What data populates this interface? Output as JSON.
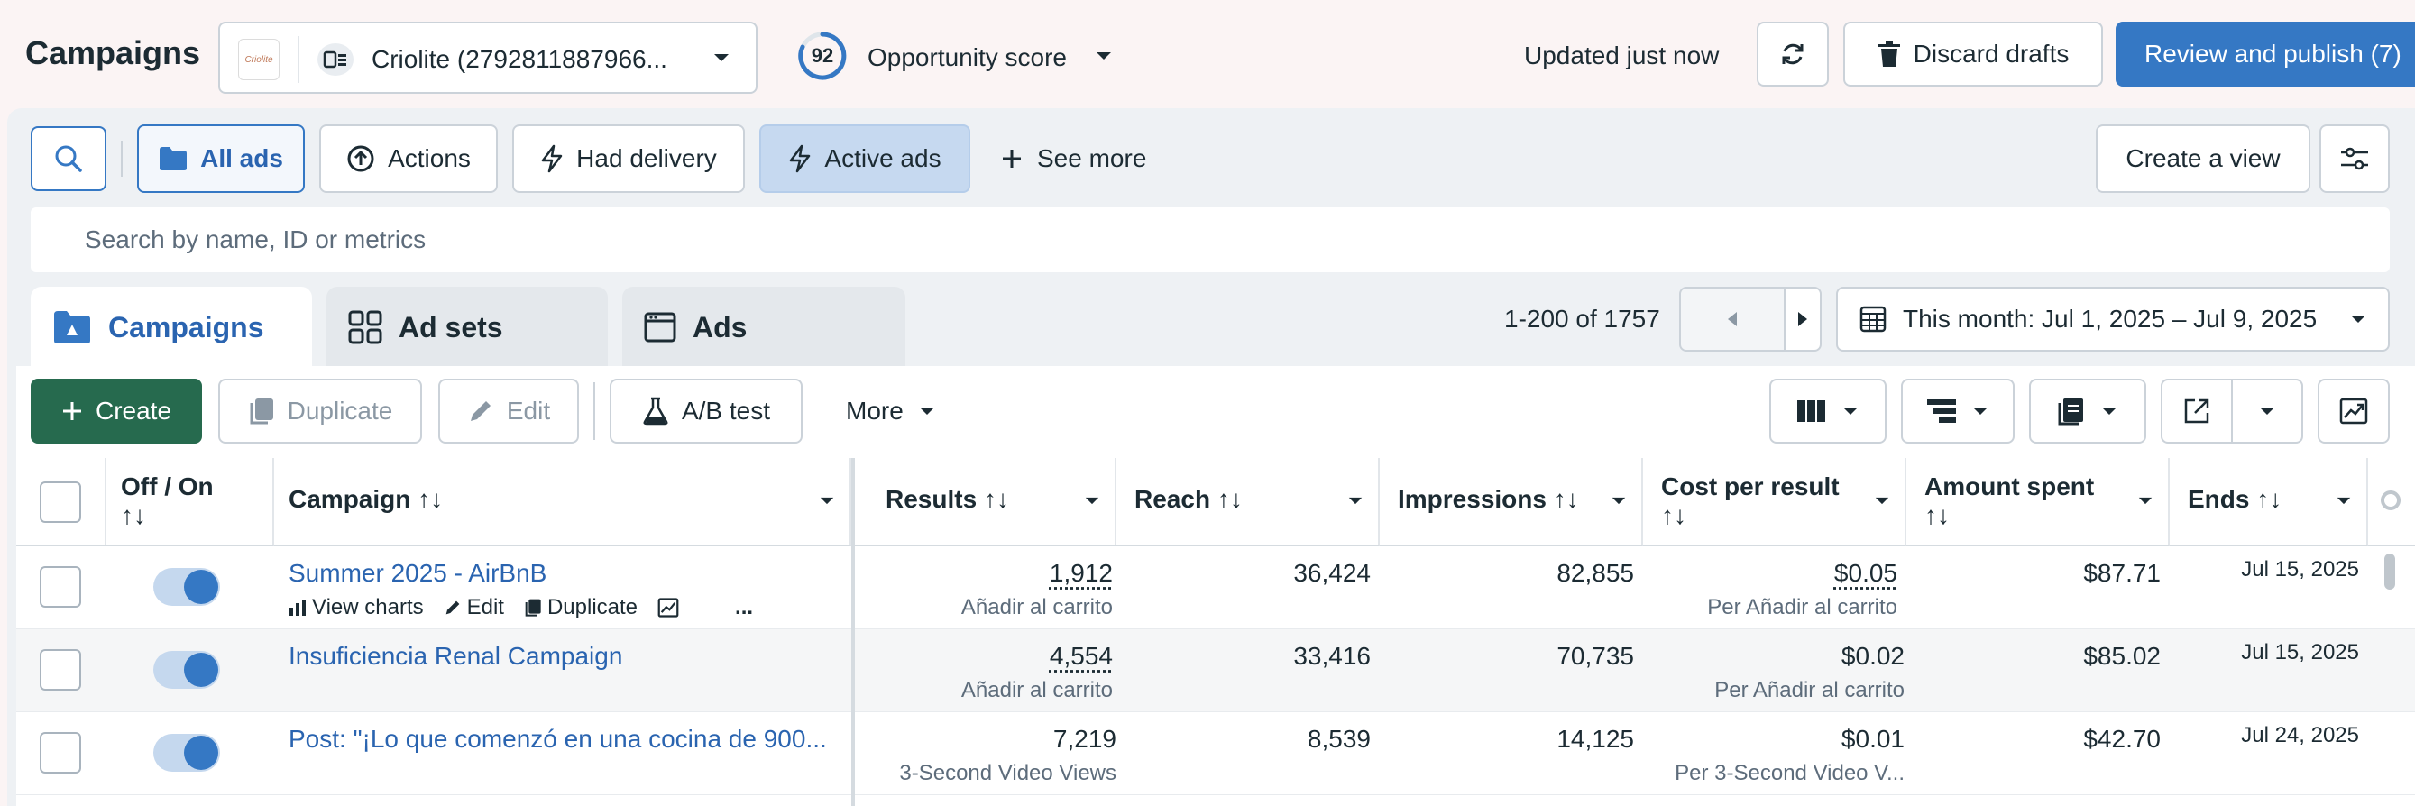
{
  "header": {
    "title": "Campaigns",
    "account_logo_text": "Criolite",
    "account_name": "Criolite (2792811887966...",
    "opportunity_score": "92",
    "opportunity_label": "Opportunity score",
    "updated": "Updated just now",
    "discard_label": "Discard drafts",
    "publish_label": "Review and publish (7)"
  },
  "filters": {
    "all_ads": "All ads",
    "actions": "Actions",
    "had_delivery": "Had delivery",
    "active_ads": "Active ads",
    "see_more": "See more",
    "create_view": "Create a view"
  },
  "search": {
    "placeholder": "Search by name, ID or metrics"
  },
  "tabs": [
    {
      "label": "Campaigns",
      "active": true
    },
    {
      "label": "Ad sets",
      "active": false
    },
    {
      "label": "Ads",
      "active": false
    }
  ],
  "pager": {
    "text": "1-200 of 1757"
  },
  "date_range": "This month: Jul 1, 2025 – Jul 9, 2025",
  "toolbar": {
    "create": "Create",
    "duplicate": "Duplicate",
    "edit": "Edit",
    "ab_test": "A/B test",
    "more": "More"
  },
  "table": {
    "columns": {
      "off_on": "Off / On",
      "campaign": "Campaign",
      "results": "Results",
      "reach": "Reach",
      "impressions": "Impressions",
      "cost_per_result": "Cost per result",
      "amount_spent": "Amount spent",
      "ends": "Ends"
    },
    "sort_glyph": "↑↓",
    "row_actions": {
      "view_charts": "View charts",
      "edit": "Edit",
      "duplicate": "Duplicate",
      "more": "..."
    },
    "rows": [
      {
        "name": "Summer 2025 - AirBnB",
        "results": "1,912",
        "results_sub": "Añadir al carrito",
        "reach": "36,424",
        "impressions": "82,855",
        "cost": "$0.05",
        "cost_sub": "Per Añadir al carrito",
        "spent": "$87.71",
        "ends": "Jul 15, 2025",
        "on": true
      },
      {
        "name": "Insuficiencia Renal Campaign",
        "results": "4,554",
        "results_sub": "Añadir al carrito",
        "reach": "33,416",
        "impressions": "70,735",
        "cost": "$0.02",
        "cost_sub": "Per Añadir al carrito",
        "spent": "$85.02",
        "ends": "Jul 15, 2025",
        "on": true
      },
      {
        "name": "Post: \"¡Lo que comenzó en una cocina de 900...",
        "results": "7,219",
        "results_sub": "3-Second Video Views",
        "reach": "8,539",
        "impressions": "14,125",
        "cost": "$0.01",
        "cost_sub": "Per 3-Second Video V...",
        "spent": "$42.70",
        "ends": "Jul 24, 2025",
        "on": true
      }
    ]
  },
  "colors": {
    "accent": "#3578c4",
    "create_green": "#266a4e",
    "link": "#2a64b0"
  }
}
